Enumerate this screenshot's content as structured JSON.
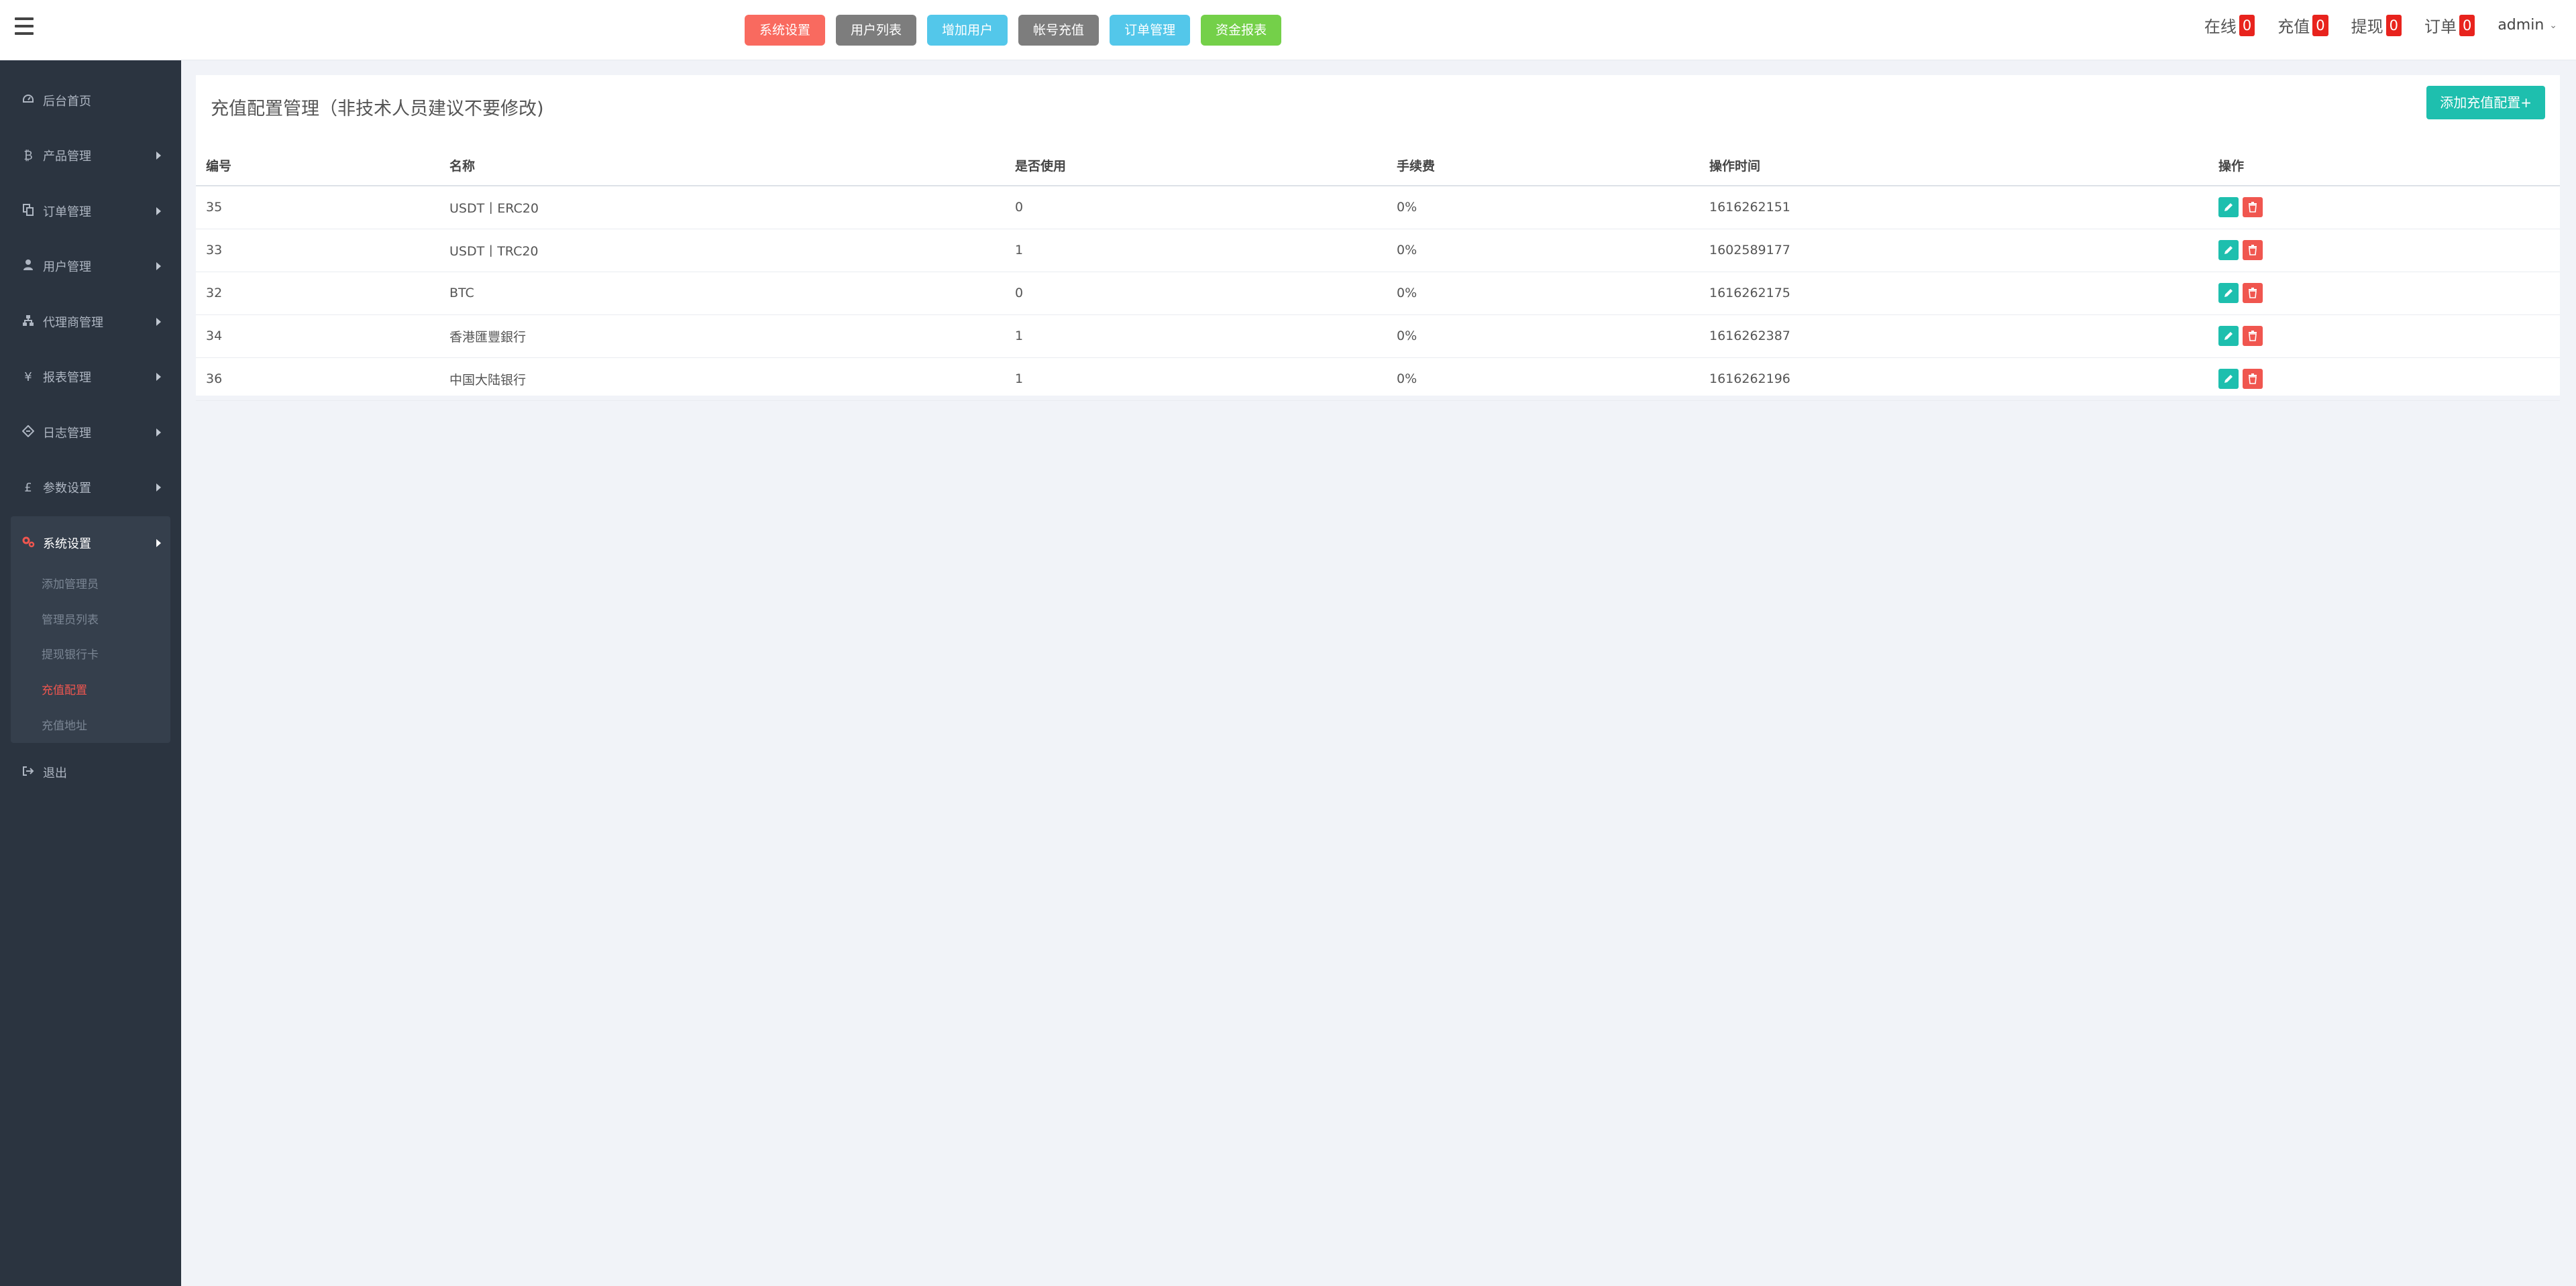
{
  "header": {
    "quick_buttons": [
      {
        "label": "系统设置",
        "color": "#f96a5f"
      },
      {
        "label": "用户列表",
        "color": "#7d7d7d"
      },
      {
        "label": "增加用户",
        "color": "#53c7ea"
      },
      {
        "label": "帐号充值",
        "color": "#7d7d7d"
      },
      {
        "label": "订单管理",
        "color": "#53c7ea"
      },
      {
        "label": "资金报表",
        "color": "#74d049"
      }
    ],
    "status": [
      {
        "label": "在线",
        "count": "0"
      },
      {
        "label": "充值",
        "count": "0"
      },
      {
        "label": "提现",
        "count": "0"
      },
      {
        "label": "订单",
        "count": "0"
      }
    ],
    "user": "admin"
  },
  "sidebar": {
    "items": [
      {
        "label": "后台首页",
        "icon": "dashboard-icon"
      },
      {
        "label": "产品管理",
        "icon": "bitcoin-icon"
      },
      {
        "label": "订单管理",
        "icon": "copy-icon"
      },
      {
        "label": "用户管理",
        "icon": "user-icon"
      },
      {
        "label": "代理商管理",
        "icon": "sitemap-icon"
      },
      {
        "label": "报表管理",
        "icon": "yen-icon"
      },
      {
        "label": "日志管理",
        "icon": "ticket-icon"
      },
      {
        "label": "参数设置",
        "icon": "pound-icon"
      },
      {
        "label": "系统设置",
        "icon": "gears-icon"
      },
      {
        "label": "退出",
        "icon": "sign-out-icon"
      }
    ],
    "submenu": [
      "添加管理员",
      "管理员列表",
      "提现银行卡",
      "充值配置",
      "充值地址"
    ]
  },
  "panel": {
    "title": "充值配置管理（非技术人员建议不要修改)",
    "add_label": "添加充值配置+",
    "columns": [
      "编号",
      "名称",
      "是否使用",
      "手续费",
      "操作时间",
      "操作"
    ],
    "rows": [
      [
        "35",
        "USDT丨ERC20",
        "0",
        "0%",
        "1616262151"
      ],
      [
        "33",
        "USDT丨TRC20",
        "1",
        "0%",
        "1602589177"
      ],
      [
        "32",
        "BTC",
        "0",
        "0%",
        "1616262175"
      ],
      [
        "34",
        "香港匯豐銀行",
        "1",
        "0%",
        "1616262387"
      ],
      [
        "36",
        "中国大陆银行",
        "1",
        "0%",
        "1616262196"
      ]
    ]
  }
}
